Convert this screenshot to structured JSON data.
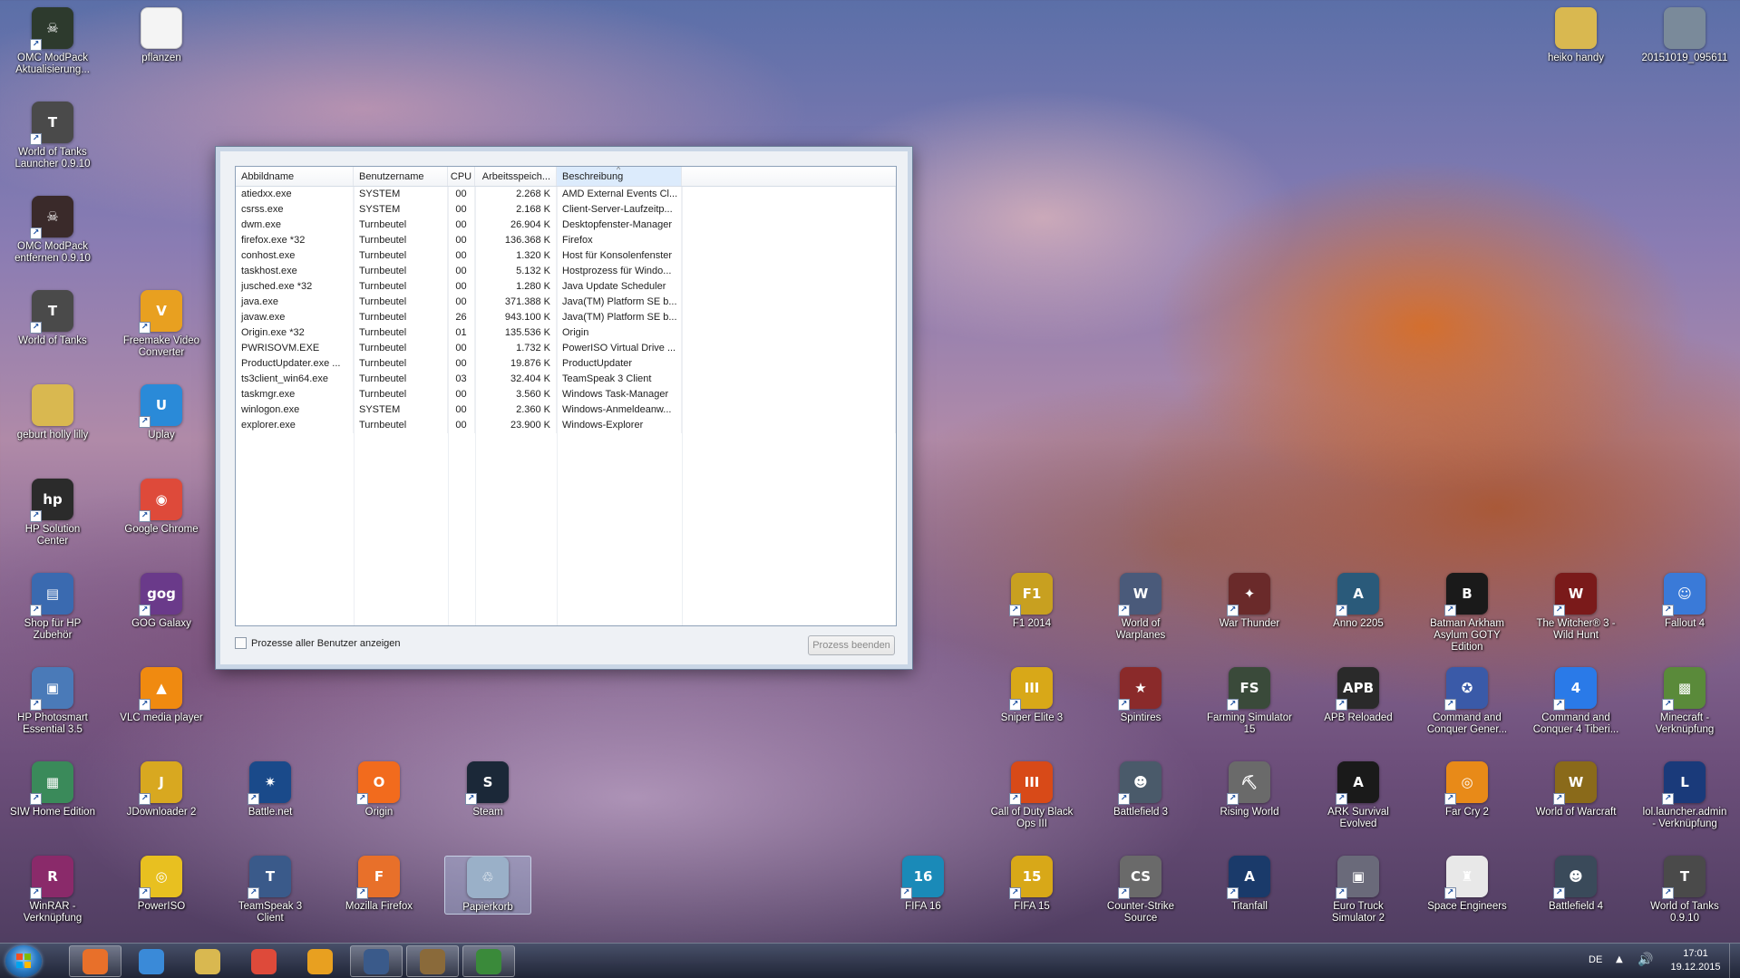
{
  "desktop_icons": [
    {
      "label": "OMC ModPack Aktualisierung...",
      "icon": "omc-modpack-icon",
      "color": "#2d3a2d",
      "glyph": "☠"
    },
    {
      "label": "pflanzen",
      "icon": "folder-icon",
      "color": "#f4f4f4",
      "glyph": ""
    },
    {
      "label": "World of Tanks Launcher 0.9.10",
      "icon": "world-of-tanks-icon",
      "color": "#4a4a4a",
      "glyph": "T"
    },
    {
      "label": "OMC ModPack entfernen 0.9.10",
      "icon": "omc-modpack-remove-icon",
      "color": "#3a2a2a",
      "glyph": "☠"
    },
    {
      "label": "World of Tanks",
      "icon": "world-of-tanks-icon",
      "color": "#4a4a4a",
      "glyph": "T"
    },
    {
      "label": "Freemake Video Converter",
      "icon": "freemake-icon",
      "color": "#e8a020",
      "glyph": "V"
    },
    {
      "label": "geburt holly lilly",
      "icon": "folder-icon",
      "color": "#d9b850",
      "glyph": ""
    },
    {
      "label": "Uplay",
      "icon": "uplay-icon",
      "color": "#2a8ad8",
      "glyph": "U"
    },
    {
      "label": "HP Solution Center",
      "icon": "hp-icon",
      "color": "#2b2b2b",
      "glyph": "hp"
    },
    {
      "label": "Google Chrome",
      "icon": "chrome-icon",
      "color": "#de4a3a",
      "glyph": "◉"
    },
    {
      "label": "Shop für HP Zubehör",
      "icon": "hp-shop-icon",
      "color": "#3a6ab0",
      "glyph": "▤"
    },
    {
      "label": "GOG Galaxy",
      "icon": "gog-icon",
      "color": "#6a3a8a",
      "glyph": "gog"
    },
    {
      "label": "HP Photosmart Essential 3.5",
      "icon": "hp-photosmart-icon",
      "color": "#4a7ab8",
      "glyph": "▣"
    },
    {
      "label": "VLC media player",
      "icon": "vlc-icon",
      "color": "#f08a10",
      "glyph": "▲"
    },
    {
      "label": "SIW Home Edition",
      "icon": "siw-icon",
      "color": "#3a8a5a",
      "glyph": "▦"
    },
    {
      "label": "JDownloader 2",
      "icon": "jdownloader-icon",
      "color": "#d8a820",
      "glyph": "J"
    },
    {
      "label": "Battle.net",
      "icon": "battlenet-icon",
      "color": "#1a4a8a",
      "glyph": "✷"
    },
    {
      "label": "Origin",
      "icon": "origin-icon",
      "color": "#f26b1d",
      "glyph": "O"
    },
    {
      "label": "Steam",
      "icon": "steam-icon",
      "color": "#1b2838",
      "glyph": "S"
    },
    {
      "label": "WinRAR - Verknüpfung",
      "icon": "winrar-icon",
      "color": "#8a2a6a",
      "glyph": "R"
    },
    {
      "label": "PowerISO",
      "icon": "poweriso-icon",
      "color": "#e8c020",
      "glyph": "◎"
    },
    {
      "label": "TeamSpeak 3 Client",
      "icon": "teamspeak-icon",
      "color": "#3a5a8a",
      "glyph": "T"
    },
    {
      "label": "Mozilla Firefox",
      "icon": "firefox-icon",
      "color": "#e8702a",
      "glyph": "F"
    },
    {
      "label": "Papierkorb",
      "icon": "recycle-bin-icon",
      "color": "#9ab0c8",
      "glyph": "♲"
    },
    {
      "label": "F1 2014",
      "icon": "f1-2014-icon",
      "color": "#c8a020",
      "glyph": "F1"
    },
    {
      "label": "World of Warplanes",
      "icon": "world-of-warplanes-icon",
      "color": "#4a5a7a",
      "glyph": "W"
    },
    {
      "label": "War Thunder",
      "icon": "war-thunder-icon",
      "color": "#6a2a2a",
      "glyph": "✦"
    },
    {
      "label": "Anno 2205",
      "icon": "anno-icon",
      "color": "#2a5a7a",
      "glyph": "A"
    },
    {
      "label": "Batman Arkham Asylum GOTY Edition",
      "icon": "batman-icon",
      "color": "#1a1a1a",
      "glyph": "B"
    },
    {
      "label": "The Witcher® 3 - Wild Hunt",
      "icon": "witcher-icon",
      "color": "#7a1a1a",
      "glyph": "W"
    },
    {
      "label": "Fallout 4",
      "icon": "fallout-icon",
      "color": "#3a7ad8",
      "glyph": "☺"
    },
    {
      "label": "Sniper Elite 3",
      "icon": "sniper-elite-icon",
      "color": "#d8a818",
      "glyph": "III"
    },
    {
      "label": "Spintires",
      "icon": "spintires-icon",
      "color": "#8a2a2a",
      "glyph": "★"
    },
    {
      "label": "Farming Simulator 15",
      "icon": "farming-simulator-icon",
      "color": "#3a4a3a",
      "glyph": "FS"
    },
    {
      "label": "APB Reloaded",
      "icon": "apb-icon",
      "color": "#2a2a2a",
      "glyph": "APB"
    },
    {
      "label": "Command and Conquer Gener...",
      "icon": "cnc-generals-icon",
      "color": "#3a5aa8",
      "glyph": "✪"
    },
    {
      "label": "Command and Conquer 4 Tiberi...",
      "icon": "cnc4-icon",
      "color": "#2a7ae8",
      "glyph": "4"
    },
    {
      "label": "Minecraft - Verknüpfung",
      "icon": "minecraft-icon",
      "color": "#5a8a3a",
      "glyph": "▩"
    },
    {
      "label": "Call of Duty Black Ops III",
      "icon": "cod-bo3-icon",
      "color": "#d84a18",
      "glyph": "III"
    },
    {
      "label": "Battlefield 3",
      "icon": "battlefield3-icon",
      "color": "#4a5a6a",
      "glyph": "☻"
    },
    {
      "label": "Rising World",
      "icon": "rising-world-icon",
      "color": "#6a6a6a",
      "glyph": "⛏"
    },
    {
      "label": "ARK Survival Evolved",
      "icon": "ark-icon",
      "color": "#1a1a1a",
      "glyph": "A"
    },
    {
      "label": "Far Cry 2",
      "icon": "far-cry-icon",
      "color": "#e88a18",
      "glyph": "◎"
    },
    {
      "label": "World of Warcraft",
      "icon": "wow-icon",
      "color": "#8a6a1a",
      "glyph": "W"
    },
    {
      "label": "lol.launcher.admin - Verknüpfung",
      "icon": "lol-icon",
      "color": "#1a3a7a",
      "glyph": "L"
    },
    {
      "label": "FIFA 16",
      "icon": "fifa16-icon",
      "color": "#1a8ab8",
      "glyph": "16"
    },
    {
      "label": "FIFA 15",
      "icon": "fifa15-icon",
      "color": "#d8a818",
      "glyph": "15"
    },
    {
      "label": "Counter-Strike Source",
      "icon": "css-icon",
      "color": "#6a6a6a",
      "glyph": "CS"
    },
    {
      "label": "Titanfall",
      "icon": "titanfall-icon",
      "color": "#1a3a6a",
      "glyph": "A"
    },
    {
      "label": "Euro Truck Simulator 2",
      "icon": "ets2-icon",
      "color": "#6a6a7a",
      "glyph": "▣"
    },
    {
      "label": "Space Engineers",
      "icon": "space-engineers-icon",
      "color": "#e8e8e8",
      "glyph": "♜"
    },
    {
      "label": "Battlefield 4",
      "icon": "battlefield4-icon",
      "color": "#3a4a5a",
      "glyph": "☻"
    },
    {
      "label": "World of Tanks 0.9.10",
      "icon": "world-of-tanks-icon",
      "color": "#4a4a4a",
      "glyph": "T"
    },
    {
      "label": "heiko handy",
      "icon": "folder-icon",
      "color": "#d9b850",
      "glyph": ""
    },
    {
      "label": "20151019_095611",
      "icon": "image-file-icon",
      "color": "#7a8a9a",
      "glyph": ""
    }
  ],
  "task_manager": {
    "columns": {
      "name": "Abbildname",
      "user": "Benutzername",
      "cpu": "CPU",
      "mem": "Arbeitsspeich...",
      "desc": "Beschreibung"
    },
    "processes": [
      {
        "name": "atiedxx.exe",
        "user": "SYSTEM",
        "cpu": "00",
        "mem": "2.268 K",
        "desc": "AMD External Events Cl..."
      },
      {
        "name": "csrss.exe",
        "user": "SYSTEM",
        "cpu": "00",
        "mem": "2.168 K",
        "desc": "Client-Server-Laufzeitp..."
      },
      {
        "name": "dwm.exe",
        "user": "Turnbeutel",
        "cpu": "00",
        "mem": "26.904 K",
        "desc": "Desktopfenster-Manager"
      },
      {
        "name": "firefox.exe *32",
        "user": "Turnbeutel",
        "cpu": "00",
        "mem": "136.368 K",
        "desc": "Firefox"
      },
      {
        "name": "conhost.exe",
        "user": "Turnbeutel",
        "cpu": "00",
        "mem": "1.320 K",
        "desc": "Host für Konsolenfenster"
      },
      {
        "name": "taskhost.exe",
        "user": "Turnbeutel",
        "cpu": "00",
        "mem": "5.132 K",
        "desc": "Hostprozess für Windo..."
      },
      {
        "name": "jusched.exe *32",
        "user": "Turnbeutel",
        "cpu": "00",
        "mem": "1.280 K",
        "desc": "Java Update Scheduler"
      },
      {
        "name": "java.exe",
        "user": "Turnbeutel",
        "cpu": "00",
        "mem": "371.388 K",
        "desc": "Java(TM) Platform SE b..."
      },
      {
        "name": "javaw.exe",
        "user": "Turnbeutel",
        "cpu": "26",
        "mem": "943.100 K",
        "desc": "Java(TM) Platform SE b..."
      },
      {
        "name": "Origin.exe *32",
        "user": "Turnbeutel",
        "cpu": "01",
        "mem": "135.536 K",
        "desc": "Origin"
      },
      {
        "name": "PWRISOVM.EXE",
        "user": "Turnbeutel",
        "cpu": "00",
        "mem": "1.732 K",
        "desc": "PowerISO Virtual Drive ..."
      },
      {
        "name": "ProductUpdater.exe ...",
        "user": "Turnbeutel",
        "cpu": "00",
        "mem": "19.876 K",
        "desc": "ProductUpdater"
      },
      {
        "name": "ts3client_win64.exe",
        "user": "Turnbeutel",
        "cpu": "03",
        "mem": "32.404 K",
        "desc": "TeamSpeak 3 Client"
      },
      {
        "name": "taskmgr.exe",
        "user": "Turnbeutel",
        "cpu": "00",
        "mem": "3.560 K",
        "desc": "Windows Task-Manager"
      },
      {
        "name": "winlogon.exe",
        "user": "SYSTEM",
        "cpu": "00",
        "mem": "2.360 K",
        "desc": "Windows-Anmeldeanw..."
      },
      {
        "name": "explorer.exe",
        "user": "Turnbeutel",
        "cpu": "00",
        "mem": "23.900 K",
        "desc": "Windows-Explorer"
      }
    ],
    "show_all_label": "Prozesse aller Benutzer anzeigen",
    "end_process_label": "Prozess beenden"
  },
  "taskbar": {
    "apps": [
      {
        "name": "firefox-taskbar-button",
        "icon": "firefox-icon",
        "color": "#e8702a",
        "active": true
      },
      {
        "name": "internet-explorer-taskbar-button",
        "icon": "internet-explorer-icon",
        "color": "#3a8ad8",
        "active": false
      },
      {
        "name": "explorer-taskbar-button",
        "icon": "folder-icon",
        "color": "#d9b850",
        "active": false
      },
      {
        "name": "chrome-taskbar-button",
        "icon": "chrome-icon",
        "color": "#de4a3a",
        "active": false
      },
      {
        "name": "media-player-taskbar-button",
        "icon": "media-player-icon",
        "color": "#e8a020",
        "active": false
      },
      {
        "name": "teamspeak-taskbar-button",
        "icon": "teamspeak-icon",
        "color": "#3a5a8a",
        "active": true
      },
      {
        "name": "minecraft-taskbar-button",
        "icon": "minecraft-icon",
        "color": "#8a6a3a",
        "active": true
      },
      {
        "name": "task-manager-taskbar-button",
        "icon": "task-manager-icon",
        "color": "#3a8a3a",
        "active": true
      }
    ],
    "language": "DE",
    "time": "17:01",
    "date": "19.12.2015"
  }
}
